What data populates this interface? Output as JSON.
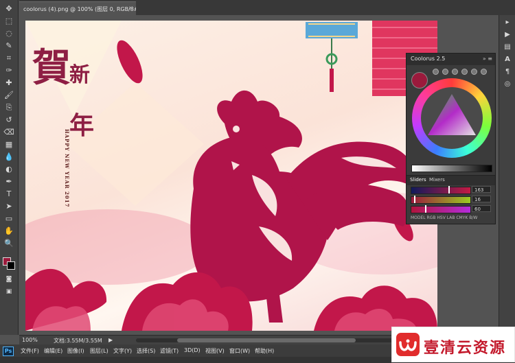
{
  "document": {
    "tab_title": "coolorus (4).png @ 100% (图层 0, RGB/8#)",
    "tab_close": "×"
  },
  "canvas": {
    "calligraphy_he": "賀",
    "calligraphy_xin": "新",
    "calligraphy_nian": "年",
    "greeting": "HAPPY NEW YEAR 2017"
  },
  "toolbar": {
    "tools": [
      "move",
      "marquee",
      "lasso",
      "quick-select",
      "crop",
      "eyedropper",
      "healing",
      "brush",
      "stamp",
      "history-brush",
      "eraser",
      "gradient",
      "blur",
      "dodge",
      "pen",
      "type",
      "path-select",
      "shape",
      "hand",
      "zoom"
    ],
    "glyphs": [
      "✥",
      "⬚",
      "◌",
      "✎",
      "⌗",
      "✑",
      "✚",
      "🖌",
      "⎘",
      "↺",
      "⌫",
      "▦",
      "💧",
      "◐",
      "✒",
      "T",
      "➤",
      "▭",
      "✋",
      "🔍"
    ],
    "foreground_color": "#9b1a3c",
    "background_color": "#000000"
  },
  "coolorus": {
    "title": "Coolorus 2.5",
    "collapse": "»",
    "menu": "≡",
    "current_color": "#9b1a3c",
    "tabs": [
      "Sliders",
      "Mixers"
    ],
    "sliders": [
      {
        "value": "163",
        "position": 0.64
      },
      {
        "value": "16",
        "position": 0.06
      },
      {
        "value": "60",
        "position": 0.24
      }
    ],
    "modes": "MODEL  RGB  HSV  LAB  CMYK  B/W"
  },
  "status": {
    "zoom": "100%",
    "doc_size": "文档:3.55M/3.55M",
    "arrow": "▶"
  },
  "menu": {
    "ps": "Ps",
    "items": [
      "文件(F)",
      "编辑(E)",
      "图像(I)",
      "图层(L)",
      "文字(Y)",
      "选择(S)",
      "滤镜(T)",
      "3D(D)",
      "视图(V)",
      "窗口(W)",
      "帮助(H)"
    ]
  },
  "watermark": {
    "text": "壹清云资源"
  },
  "colors": {
    "rooster": "#b0144a",
    "accent": "#9b1a3c"
  }
}
